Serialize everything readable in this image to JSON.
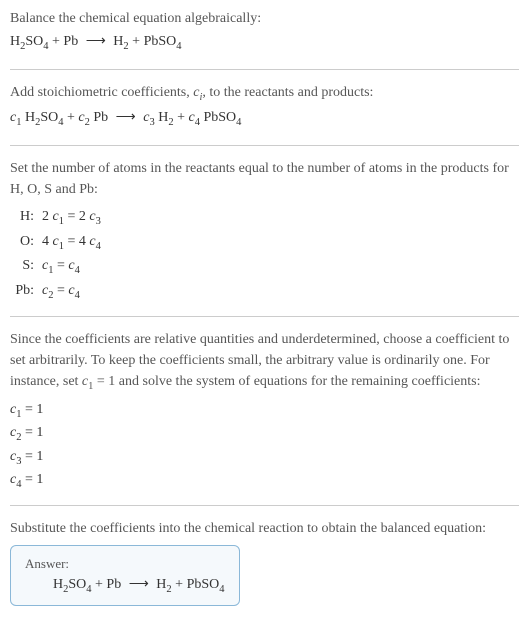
{
  "section1": {
    "intro": "Balance the chemical equation algebraically:",
    "equation_html": "H<sub>2</sub>SO<sub>4</sub> + Pb <span class='arrow'>⟶</span> H<sub>2</sub> + PbSO<sub>4</sub>"
  },
  "section2": {
    "intro_html": "Add stoichiometric coefficients, <span class='italic-c'>c<sub>i</sub></span>, to the reactants and products:",
    "equation_html": "<span class='italic-c'>c</span><sub>1</sub> H<sub>2</sub>SO<sub>4</sub> + <span class='italic-c'>c</span><sub>2</sub> Pb <span class='arrow'>⟶</span> <span class='italic-c'>c</span><sub>3</sub> H<sub>2</sub> + <span class='italic-c'>c</span><sub>4</sub> PbSO<sub>4</sub>"
  },
  "section3": {
    "intro": "Set the number of atoms in the reactants equal to the number of atoms in the products for H, O, S and Pb:",
    "rows": [
      {
        "label": "H:",
        "eq_html": "2 <span class='italic-c'>c</span><sub>1</sub> = 2 <span class='italic-c'>c</span><sub>3</sub>"
      },
      {
        "label": "O:",
        "eq_html": "4 <span class='italic-c'>c</span><sub>1</sub> = 4 <span class='italic-c'>c</span><sub>4</sub>"
      },
      {
        "label": "S:",
        "eq_html": "<span class='italic-c'>c</span><sub>1</sub> = <span class='italic-c'>c</span><sub>4</sub>"
      },
      {
        "label": "Pb:",
        "eq_html": "<span class='italic-c'>c</span><sub>2</sub> = <span class='italic-c'>c</span><sub>4</sub>"
      }
    ]
  },
  "section4": {
    "intro_html": "Since the coefficients are relative quantities and underdetermined, choose a coefficient to set arbitrarily. To keep the coefficients small, the arbitrary value is ordinarily one. For instance, set <span class='italic-c'>c</span><sub>1</sub> = 1 and solve the system of equations for the remaining coefficients:",
    "coefs": [
      {
        "html": "<span class='italic-c'>c</span><sub>1</sub> = 1"
      },
      {
        "html": "<span class='italic-c'>c</span><sub>2</sub> = 1"
      },
      {
        "html": "<span class='italic-c'>c</span><sub>3</sub> = 1"
      },
      {
        "html": "<span class='italic-c'>c</span><sub>4</sub> = 1"
      }
    ]
  },
  "section5": {
    "intro": "Substitute the coefficients into the chemical reaction to obtain the balanced equation:",
    "answer_label": "Answer:",
    "answer_eq_html": "H<sub>2</sub>SO<sub>4</sub> + Pb <span class='arrow'>⟶</span> H<sub>2</sub> + PbSO<sub>4</sub>"
  }
}
